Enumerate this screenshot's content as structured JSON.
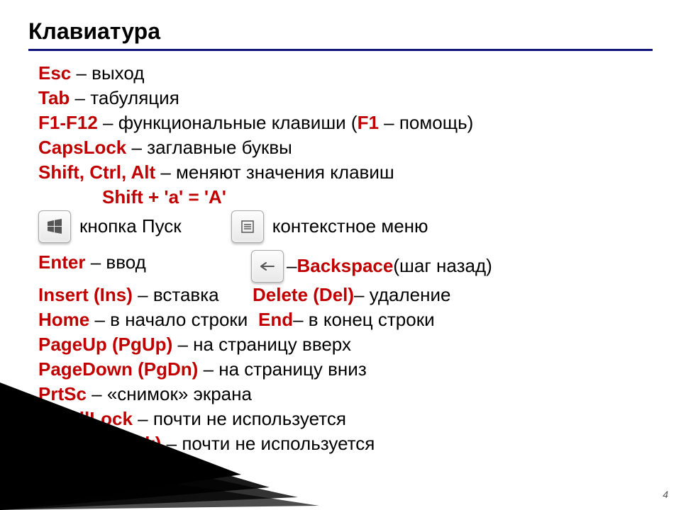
{
  "title": "Клавиатура",
  "page_number": "4",
  "lines": {
    "esc": {
      "key": "Esc",
      "desc": " – выход"
    },
    "tab": {
      "key": "Tab",
      "desc": " – табуляция"
    },
    "fkeys": {
      "key1": "F1-F12",
      "mid": " – функциональные клавиши (",
      "key2": "F1",
      "end": " – помощь)"
    },
    "caps": {
      "key": "CapsLock",
      "desc": " – заглавные буквы"
    },
    "mods": {
      "key": "Shift, Ctrl, Alt",
      "desc": " – меняют значения клавиш"
    },
    "shift_ex": {
      "text": "Shift + 'a' = 'A'"
    },
    "win_row": {
      "start_label": "кнопка Пуск",
      "ctx_label": "контекстное меню"
    },
    "enter": {
      "key": "Enter",
      "desc": " – ввод"
    },
    "backspace": {
      "dash": " – ",
      "key": "Backspace",
      "desc": " (шаг назад)"
    },
    "insert": {
      "key": "Insert (Ins)",
      "desc": " – вставка"
    },
    "delete": {
      "key": "Delete (Del)",
      "desc": " – удаление"
    },
    "home": {
      "key": "Home",
      "desc": " – в начало строки"
    },
    "end": {
      "key": "End",
      "desc": " – в конец строки"
    },
    "pgup": {
      "key": "PageUp (PgUp)",
      "desc": " – на страницу вверх"
    },
    "pgdn": {
      "key": "PageDown (PgDn)",
      "desc": " – на страницу вниз"
    },
    "prtsc": {
      "key": "PrtSc",
      "desc": " – «снимок» экрана"
    },
    "scroll": {
      "key": "ScrollLock",
      "desc": " – почти не используется"
    },
    "pause": {
      "key": "Pause (Break)",
      "desc": " – почти не используется"
    }
  }
}
